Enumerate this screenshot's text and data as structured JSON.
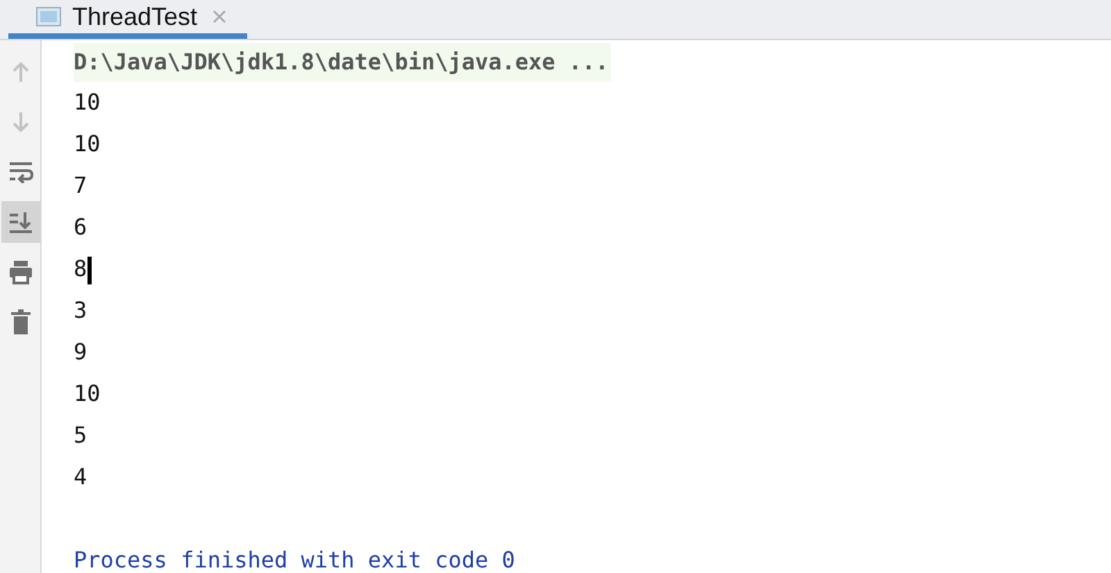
{
  "tab": {
    "title": "ThreadTest",
    "selected": true
  },
  "toolbar": [
    {
      "kind": "up",
      "disabled": true,
      "selected": false
    },
    {
      "kind": "down",
      "disabled": true,
      "selected": false
    },
    {
      "kind": "wrap",
      "disabled": false,
      "selected": false
    },
    {
      "kind": "scroll-end",
      "disabled": false,
      "selected": true
    },
    {
      "kind": "print",
      "disabled": false,
      "selected": false
    },
    {
      "kind": "trash",
      "disabled": false,
      "selected": false
    }
  ],
  "console": [
    {
      "kind": "command",
      "text": "D:\\Java\\JDK\\jdk1.8\\date\\bin\\java.exe ...",
      "cursor": false
    },
    {
      "kind": "output",
      "text": "10",
      "cursor": false
    },
    {
      "kind": "output",
      "text": "10",
      "cursor": false
    },
    {
      "kind": "output",
      "text": "7",
      "cursor": false
    },
    {
      "kind": "output",
      "text": "6",
      "cursor": false
    },
    {
      "kind": "output",
      "text": "8",
      "cursor": true
    },
    {
      "kind": "output",
      "text": "3",
      "cursor": false
    },
    {
      "kind": "output",
      "text": "9",
      "cursor": false
    },
    {
      "kind": "output",
      "text": "10",
      "cursor": false
    },
    {
      "kind": "output",
      "text": "5",
      "cursor": false
    },
    {
      "kind": "output",
      "text": "4",
      "cursor": false
    },
    {
      "kind": "exit",
      "text": "Process finished with exit code 0",
      "cursor": false
    }
  ]
}
